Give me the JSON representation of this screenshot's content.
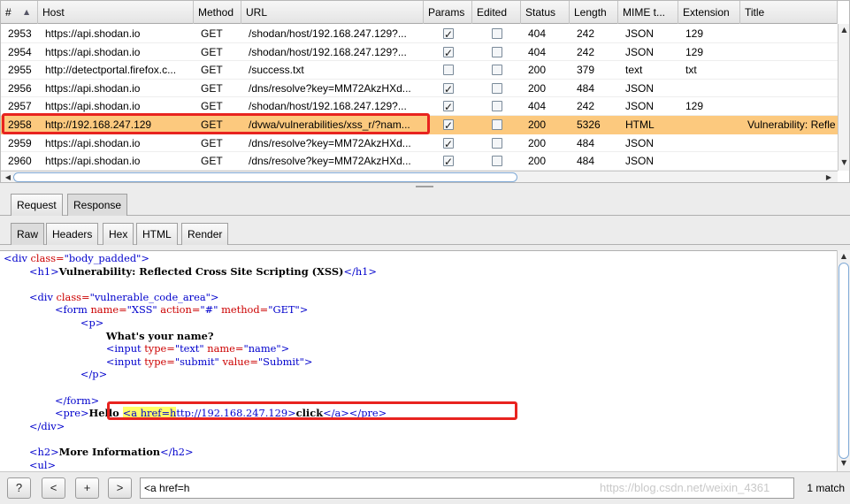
{
  "history": {
    "columns": [
      "#",
      "Host",
      "Method",
      "URL",
      "Params",
      "Edited",
      "Status",
      "Length",
      "MIME t...",
      "Extension",
      "Title"
    ],
    "sort_indicator": "▲",
    "rows": [
      {
        "id": "2953",
        "host": "https://api.shodan.io",
        "method": "GET",
        "url": "/shodan/host/192.168.247.129?...",
        "params": true,
        "edited": false,
        "status": "404",
        "length": "242",
        "mime": "JSON",
        "ext": "129",
        "title": ""
      },
      {
        "id": "2954",
        "host": "https://api.shodan.io",
        "method": "GET",
        "url": "/shodan/host/192.168.247.129?...",
        "params": true,
        "edited": false,
        "status": "404",
        "length": "242",
        "mime": "JSON",
        "ext": "129",
        "title": ""
      },
      {
        "id": "2955",
        "host": "http://detectportal.firefox.c...",
        "method": "GET",
        "url": "/success.txt",
        "params": false,
        "edited": false,
        "status": "200",
        "length": "379",
        "mime": "text",
        "ext": "txt",
        "title": ""
      },
      {
        "id": "2956",
        "host": "https://api.shodan.io",
        "method": "GET",
        "url": "/dns/resolve?key=MM72AkzHXd...",
        "params": true,
        "edited": false,
        "status": "200",
        "length": "484",
        "mime": "JSON",
        "ext": "",
        "title": ""
      },
      {
        "id": "2957",
        "host": "https://api.shodan.io",
        "method": "GET",
        "url": "/shodan/host/192.168.247.129?...",
        "params": true,
        "edited": false,
        "status": "404",
        "length": "242",
        "mime": "JSON",
        "ext": "129",
        "title": ""
      },
      {
        "id": "2958",
        "host": "http://192.168.247.129",
        "method": "GET",
        "url": "/dvwa/vulnerabilities/xss_r/?nam...",
        "params": true,
        "edited": false,
        "status": "200",
        "length": "5326",
        "mime": "HTML",
        "ext": "",
        "title": "Vulnerability: Refle",
        "selected": true
      },
      {
        "id": "2959",
        "host": "https://api.shodan.io",
        "method": "GET",
        "url": "/dns/resolve?key=MM72AkzHXd...",
        "params": true,
        "edited": false,
        "status": "200",
        "length": "484",
        "mime": "JSON",
        "ext": "",
        "title": ""
      },
      {
        "id": "2960",
        "host": "https://api.shodan.io",
        "method": "GET",
        "url": "/dns/resolve?key=MM72AkzHXd...",
        "params": true,
        "edited": false,
        "status": "200",
        "length": "484",
        "mime": "JSON",
        "ext": "",
        "title": ""
      }
    ]
  },
  "tabs": {
    "outer": [
      "Request",
      "Response"
    ],
    "outer_active": "Response",
    "inner": [
      "Raw",
      "Headers",
      "Hex",
      "HTML",
      "Render"
    ],
    "inner_active": "Raw"
  },
  "code_lines": [
    [
      [
        "t",
        "<div "
      ],
      [
        "a",
        "class="
      ],
      [
        "t",
        "\"body_padded\">"
      ]
    ],
    [
      [
        "p",
        "        "
      ],
      [
        "t",
        "<h1>"
      ],
      [
        "k",
        "Vulnerability: Reflected Cross Site Scripting (XSS)"
      ],
      [
        "t",
        "</h1>"
      ]
    ],
    [],
    [
      [
        "p",
        "        "
      ],
      [
        "t",
        "<div "
      ],
      [
        "a",
        "class="
      ],
      [
        "t",
        "\"vulnerable_code_area\">"
      ]
    ],
    [
      [
        "p",
        "                "
      ],
      [
        "t",
        "<form "
      ],
      [
        "a",
        "name="
      ],
      [
        "t",
        "\"XSS\" "
      ],
      [
        "a",
        "action="
      ],
      [
        "t",
        "\"#\" "
      ],
      [
        "a",
        "method="
      ],
      [
        "t",
        "\"GET\">"
      ]
    ],
    [
      [
        "p",
        "                        "
      ],
      [
        "t",
        "<p>"
      ]
    ],
    [
      [
        "p",
        "                                "
      ],
      [
        "k",
        "What's your name?"
      ]
    ],
    [
      [
        "p",
        "                                "
      ],
      [
        "t",
        "<input "
      ],
      [
        "a",
        "type="
      ],
      [
        "t",
        "\"text\" "
      ],
      [
        "a",
        "name="
      ],
      [
        "t",
        "\"name\">"
      ]
    ],
    [
      [
        "p",
        "                                "
      ],
      [
        "t",
        "<input "
      ],
      [
        "a",
        "type="
      ],
      [
        "t",
        "\"submit\" "
      ],
      [
        "a",
        "value="
      ],
      [
        "t",
        "\"Submit\">"
      ]
    ],
    [
      [
        "p",
        "                        "
      ],
      [
        "t",
        "</p>"
      ]
    ],
    [],
    [
      [
        "p",
        "                "
      ],
      [
        "t",
        "</form>"
      ]
    ],
    [
      [
        "p",
        "                "
      ],
      [
        "t",
        "<pre>"
      ],
      [
        "k",
        "Hello "
      ],
      [
        "h",
        "<a href=h"
      ],
      [
        "t",
        "ttp://192.168.247.129>"
      ],
      [
        "k",
        "click"
      ],
      [
        "t",
        "</a></pre>"
      ]
    ],
    [
      [
        "p",
        "        "
      ],
      [
        "t",
        "</div>"
      ]
    ],
    [],
    [
      [
        "p",
        "        "
      ],
      [
        "t",
        "<h2>"
      ],
      [
        "k",
        "More Information"
      ],
      [
        "t",
        "</h2>"
      ]
    ],
    [
      [
        "p",
        "        "
      ],
      [
        "t",
        "<ul>"
      ]
    ]
  ],
  "search": {
    "help_label": "?",
    "prev_label": "<",
    "add_label": "+",
    "next_label": ">",
    "query": "<a href=h",
    "match_count": "1 match",
    "watermark": "https://blog.csdn.net/weixin_4361"
  },
  "colors": {
    "selected_row": "#fcc97e",
    "highlight_red": "#e8231f",
    "search_highlight": "#ffff66",
    "tag_blue": "#0000cc",
    "attr_red": "#cc0000"
  }
}
